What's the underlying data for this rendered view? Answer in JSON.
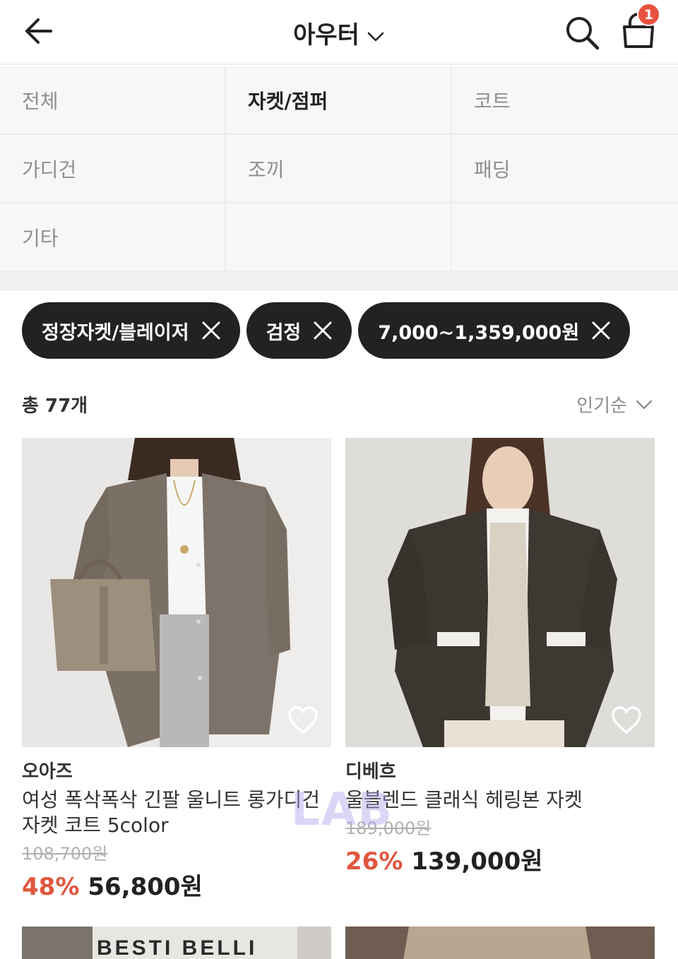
{
  "header": {
    "title": "아우터",
    "cart_count": "1"
  },
  "categories": [
    "전체",
    "자켓/점퍼",
    "코트",
    "가디건",
    "조끼",
    "패딩",
    "기타"
  ],
  "active_category": "자켓/점퍼",
  "filters": [
    "정장자켓/블레이저",
    "검정",
    "7,000~1,359,000원"
  ],
  "list": {
    "count_label": "총 77개",
    "sort_label": "인기순"
  },
  "products": [
    {
      "brand": "오아즈",
      "name": "여성 폭삭폭삭 긴팔 울니트 롱가디건 자켓 코트 5color",
      "original_price": "108,700원",
      "discount": "48%",
      "price": "56,800원"
    },
    {
      "brand": "디베흐",
      "name": "울블렌드 클래식 헤링본 자켓",
      "original_price": "189,000원",
      "discount": "26%",
      "price": "139,000원"
    }
  ],
  "partial_products": [
    {
      "image_text": "BESTI BELLI"
    }
  ],
  "watermark": "LAB",
  "colors": {
    "accent": "#e0563f",
    "chip_bg": "#222222",
    "badge": "#e8533f"
  }
}
